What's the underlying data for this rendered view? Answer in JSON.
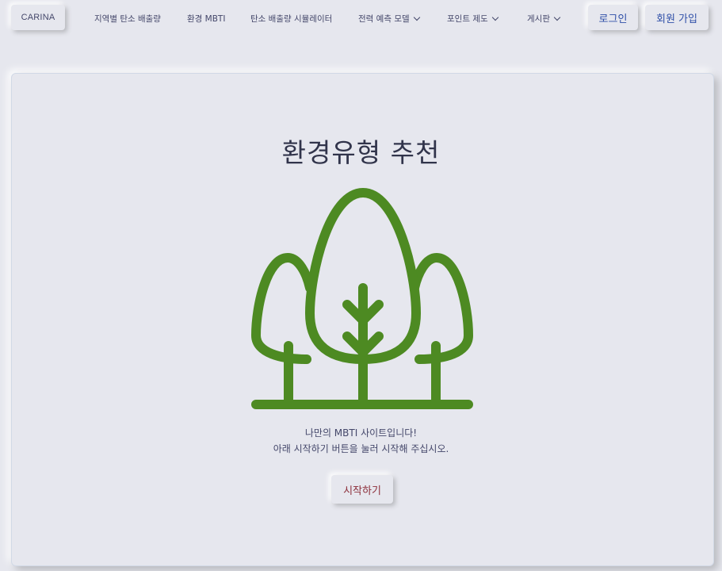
{
  "navbar": {
    "brand": "CARINA",
    "links": [
      {
        "label": "지역별 탄소 배출량"
      },
      {
        "label": "환경 MBTI"
      },
      {
        "label": "탄소 배출량 시뮬레이터"
      },
      {
        "label": "전력 예측 모델"
      },
      {
        "label": "포인트 제도"
      },
      {
        "label": "게시판"
      }
    ],
    "login": "로그인",
    "signup": "회원 가입"
  },
  "main": {
    "title": "환경유형 추천",
    "icon": "trees-icon",
    "line1": "나만의 MBTI 사이트입니다!",
    "line2": "아래 시작하기 버튼을 눌러 시작해 주십시오.",
    "start_button": "시작하기"
  },
  "colors": {
    "background": "#e6e7ee",
    "tree_green": "#4d8a22",
    "link_blue": "#2f4fa8",
    "start_text": "#8c2e3a"
  }
}
